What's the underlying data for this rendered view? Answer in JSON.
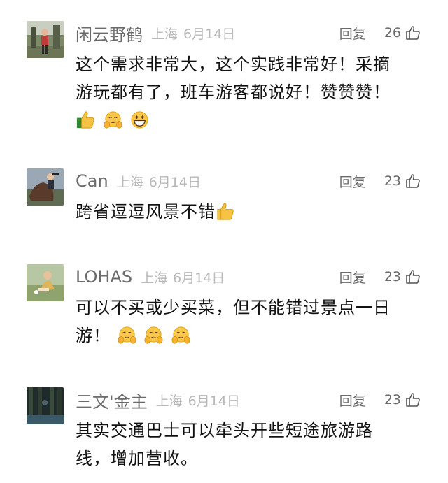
{
  "comments": [
    {
      "username": "闲云野鹤",
      "location": "上海",
      "date": "6月14日",
      "reply_label": "回复",
      "likes": "26",
      "text_line1": "这个需求非常大，这个实践非常好！采摘",
      "text_line2": "游玩都有了，班车游客都说好！赞赞赞！",
      "emojis": [
        "thumbs-up",
        "hugging-face",
        "grinning-face"
      ]
    },
    {
      "username": "Can",
      "location": "上海",
      "date": "6月14日",
      "reply_label": "回复",
      "likes": "23",
      "text_line1": "跨省逗逗风景不错",
      "emojis": [
        "thumbs-up"
      ]
    },
    {
      "username": "LOHAS",
      "location": "上海",
      "date": "6月14日",
      "reply_label": "回复",
      "likes": "23",
      "text_line1": "可以不买或少买菜，但不能错过景点一日",
      "text_line2": "游！",
      "emojis": [
        "hugging-face",
        "hugging-face",
        "hugging-face"
      ]
    },
    {
      "username": "三文'金主",
      "location": "上海",
      "date": "6月14日",
      "reply_label": "回复",
      "likes": "23",
      "text_line1": "其实交通巴士可以牵头开些短途旅游路",
      "text_line2": "线，增加营收。",
      "emojis": []
    }
  ]
}
